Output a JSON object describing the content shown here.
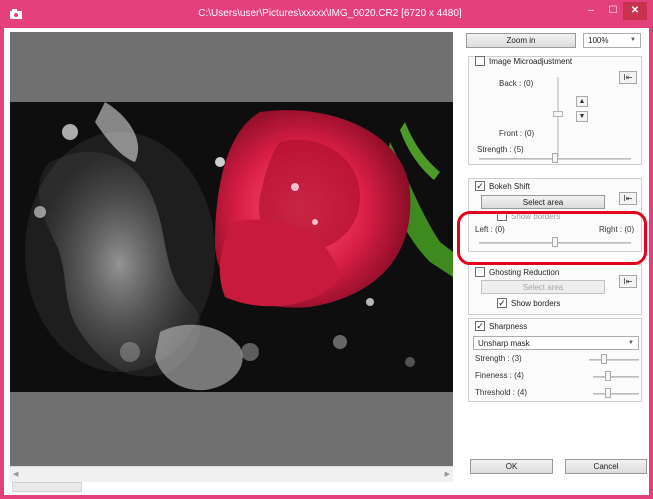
{
  "window": {
    "title": "C:\\Users\\user\\Pictures\\xxxxx\\IMG_0020.CR2 [6720 x 4480]",
    "controls": {
      "minimize": "–",
      "maximize": "☐",
      "close": "✕"
    },
    "accent_color": "#e4407b"
  },
  "toolbar": {
    "zoom_in_label": "Zoom in",
    "zoom_value": "100%"
  },
  "microadjust": {
    "title": "Image Microadjustment",
    "checked": false,
    "back_label": "Back : (0)",
    "front_label": "Front : (0)",
    "strength_label": "Strength : (5)"
  },
  "bokeh": {
    "title": "Bokeh Shift",
    "checked": true,
    "select_area_label": "Select area",
    "show_borders_label": "Show borders",
    "left_label": "Left : (0)",
    "right_label": "Right : (0)",
    "slider_value": 0
  },
  "ghosting": {
    "title": "Ghosting Reduction",
    "checked": false,
    "select_area_label": "Select area",
    "show_borders_label": "Show borders",
    "show_borders_checked": true
  },
  "sharpness": {
    "title": "Sharpness",
    "checked": true,
    "mode": "Unsharp mask",
    "strength_label": "Strength : (3)",
    "fineness_label": "Fineness : (4)",
    "threshold_label": "Threshold : (4)"
  },
  "footer": {
    "ok_label": "OK",
    "cancel_label": "Cancel"
  },
  "icons": {
    "app": "app-icon",
    "reset": "reset-icon",
    "reset_glyph": "I⇤",
    "up": "▲",
    "down": "▼",
    "check": "✓",
    "caret": "▼"
  }
}
